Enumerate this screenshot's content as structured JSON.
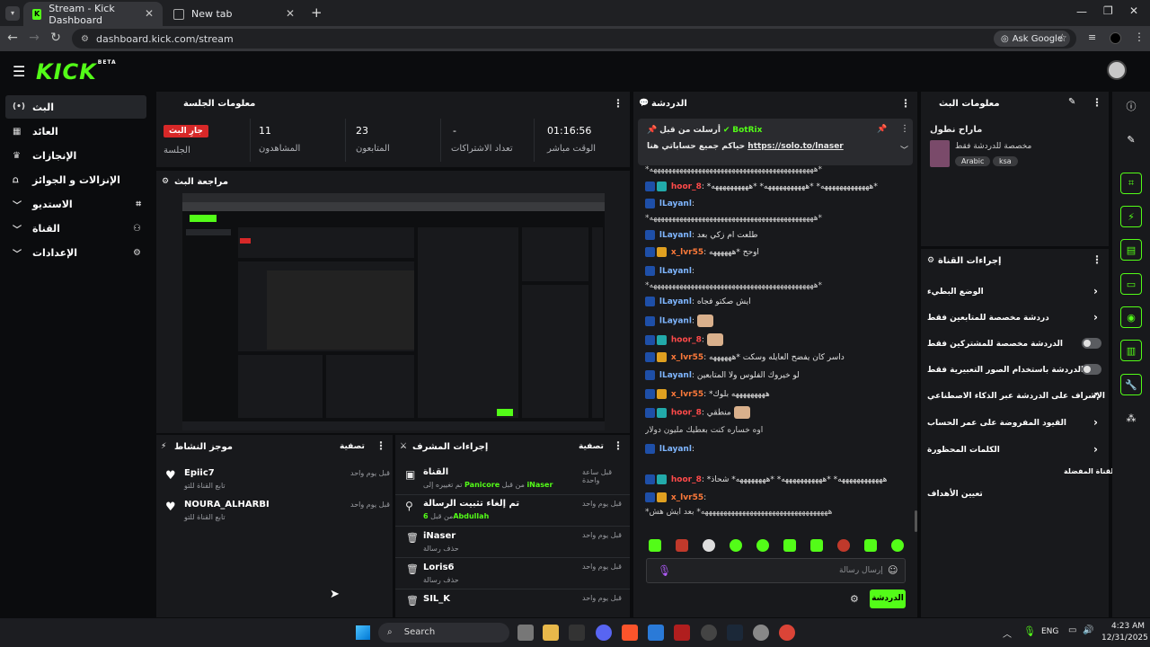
{
  "browser": {
    "tabs": [
      {
        "title": "Stream - Kick Dashboard",
        "active": true
      },
      {
        "title": "New tab",
        "active": false
      }
    ],
    "url": "dashboard.kick.com/stream",
    "ask_google": "Ask Google"
  },
  "site": {
    "logo": "KICK",
    "logo_sup": "BETA"
  },
  "sidebar": {
    "items": [
      {
        "label": "البث",
        "icon": "broadcast-icon",
        "active": true
      },
      {
        "label": "العائد",
        "icon": "earnings-icon"
      },
      {
        "label": "الإنجازات",
        "icon": "trophy-icon"
      },
      {
        "label": "الإنزالات و الجوائز",
        "icon": "drops-icon"
      },
      {
        "label": "الاستديو",
        "icon": "studio-icon",
        "expand": true
      },
      {
        "label": "القناة",
        "icon": "channel-icon",
        "expand": true
      },
      {
        "label": "الإعدادات",
        "icon": "gear-icon",
        "expand": true
      }
    ]
  },
  "session": {
    "title": "معلومات الجلسة",
    "stats": [
      {
        "value": "01:16:56",
        "label": "الوقت مباشر"
      },
      {
        "value": "-",
        "label": "تعداد الاشتراكات"
      },
      {
        "value": "23",
        "label": "المتابعون"
      },
      {
        "value": "11",
        "label": "المشاهدون"
      },
      {
        "value": "جارِ البث",
        "label": "الجلسة"
      }
    ]
  },
  "preview": {
    "title": "مراجعة البث"
  },
  "activity": {
    "title": "موجز النشاط",
    "filter": "تصفية",
    "items": [
      {
        "name": "Epiic7",
        "sub": "تابع القناة للتو",
        "time": "قبل يوم واحد"
      },
      {
        "name": "NOURA_ALHARBI",
        "sub": "تابع القناة للتو",
        "time": "قبل يوم واحد"
      }
    ]
  },
  "mod": {
    "title": "إجراءات المشرف",
    "filter": "تصفية",
    "items": [
      {
        "title": "القناة",
        "sub_prefix": "تم تغييره إلى",
        "sub_user": "Panicore",
        "sub_mid": "من قبل",
        "sub_user2": "iNaser",
        "time": "قبل ساعة واحدة"
      },
      {
        "title": "تم إلغاء تثبيت الرسالة",
        "sub_prefix": "من قبل",
        "sub_user": "6Abdullah",
        "time": "قبل يوم واحد"
      },
      {
        "title": "iNaser",
        "sub_prefix": "حذف رسالة",
        "time": "قبل يوم واحد"
      },
      {
        "title": "Loris6",
        "sub_prefix": "حذف رسالة",
        "time": "قبل يوم واحد"
      },
      {
        "title": "SIL_K",
        "sub_prefix": "",
        "time": "قبل يوم واحد"
      }
    ]
  },
  "chat": {
    "title": "الدردشة",
    "pinned": {
      "by_label": "أرسلت من قبل",
      "bot": "BotRix",
      "text": "حياكم جميع حساباتي هنا",
      "link": "https://solo.to/lnaser"
    },
    "messages": [
      {
        "user": "",
        "text": "*ههههههههههههههههههههههههههههههههههههههههههههه*"
      },
      {
        "user": "hoor_8",
        "color": "#ff4a4a",
        "text": "*هههههههههههههه* *هههههههههههه* *ههههههههههه*"
      },
      {
        "user": "lLayanl",
        "color": "#7fb6ff",
        "text": ""
      },
      {
        "user": "",
        "text": "*ههههههههههههههههههههههههههههههههههههههههههههه*"
      },
      {
        "user": "lLayanl",
        "color": "#7fb6ff",
        "text": "طلعت ام زكي بعد"
      },
      {
        "user": "x_lvr55",
        "color": "#ff7a3a",
        "text": "اوحح *ههههههه"
      },
      {
        "user": "lLayanl",
        "color": "#7fb6ff",
        "text": ""
      },
      {
        "user": "",
        "text": "*ههههههههههههههههههههههههههههههههههههههههههههه*"
      },
      {
        "user": "lLayanl",
        "color": "#7fb6ff",
        "text": "ايش صكتو فجاه"
      },
      {
        "user": "lLayanl",
        "color": "#7fb6ff",
        "text": ""
      },
      {
        "user": "hoor_8",
        "color": "#ff4a4a",
        "text": ""
      },
      {
        "user": "x_lvr55",
        "color": "#ff7a3a",
        "text": "داسر كان يفضح العايله وسكت *ههههههه"
      },
      {
        "user": "lLayanl",
        "color": "#7fb6ff",
        "text": "لو خيروك الفلوس ولا المتابعين"
      },
      {
        "user": "x_lvr55",
        "color": "#ff7a3a",
        "text": "*هههههههههه بلوك"
      },
      {
        "user": "hoor_8",
        "color": "#ff4a4a",
        "text": "منطقي"
      },
      {
        "user": "",
        "text": "اوه خساره كنت بعطيك مليون دولار"
      },
      {
        "user": "lLayanl",
        "color": "#7fb6ff",
        "text": ""
      },
      {
        "user": "hoor_8",
        "color": "#ff4a4a",
        "text": "*ههههههههههههه* *هههههههههههه* *ههههههههه* شحاذ"
      },
      {
        "user": "x_lvr55",
        "color": "#ff7a3a",
        "text": ""
      },
      {
        "user": "",
        "text": "*ههههههههههههههههههههههههههههههههههه* بعد ايش هش"
      }
    ],
    "input_placeholder": "إرسال رسالة",
    "send_label": "الدردشة"
  },
  "stream_info": {
    "title": "معلومات البث",
    "stream_title": "ماراح نطول",
    "category": "مخصصة للدردشة فقط",
    "tags": [
      "Arabic",
      "ksa"
    ]
  },
  "channel_actions": {
    "title": "إجراءات القناة",
    "items": [
      {
        "label": "الوضع البطيء",
        "type": "chevron"
      },
      {
        "label": "دردشة مخصصة للمتابعين فقط",
        "type": "chevron"
      },
      {
        "label": "الدردشة مخصصة للمشتركين فقط",
        "type": "toggle"
      },
      {
        "label": "الدردشة باستخدام الصور التعبيرية فقط",
        "type": "toggle"
      },
      {
        "label": "الإشراف على الدردشة عبر الذكاء الاصطناعي",
        "type": "external"
      },
      {
        "label": "القيود المفروضة على عمر الحساب",
        "type": "chevron"
      },
      {
        "label": "الكلمات المحظورة",
        "type": "chevron"
      }
    ],
    "preferred_title": "القناة المفضلة",
    "goals": "تعيين الأهداف"
  },
  "taskbar": {
    "search": "Search",
    "lang": "ENG",
    "time": "4:23 AM",
    "date": "12/31/2025"
  },
  "colors": {
    "accent": "#53fc18",
    "live": "#d72828"
  }
}
